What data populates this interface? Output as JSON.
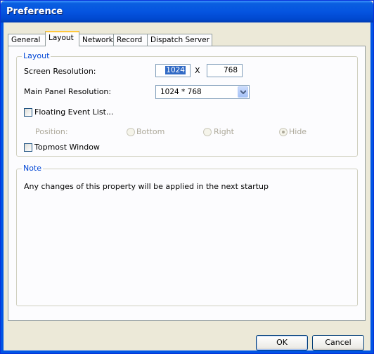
{
  "window": {
    "title": "Preference"
  },
  "tabs": [
    "General",
    "Layout",
    "Network",
    "Record",
    "Dispatch Server"
  ],
  "active_tab": "Layout",
  "layout_group": {
    "legend": "Layout",
    "screen_resolution": {
      "label": "Screen Resolution:",
      "width": "1024",
      "separator": "X",
      "height": "768"
    },
    "main_panel_resolution": {
      "label": "Main Panel Resolution:",
      "value": "1024 * 768"
    },
    "floating_event_list": {
      "label": "Floating Event List...",
      "checked": false
    },
    "position": {
      "label": "Position:",
      "options": [
        "Bottom",
        "Right",
        "Hide"
      ],
      "selected": "Hide"
    },
    "topmost_window": {
      "label": "Topmost Window",
      "checked": false
    }
  },
  "note_group": {
    "legend": "Note",
    "text": "Any changes of this property will be applied in the next startup"
  },
  "buttons": {
    "ok": "OK",
    "cancel": "Cancel"
  }
}
